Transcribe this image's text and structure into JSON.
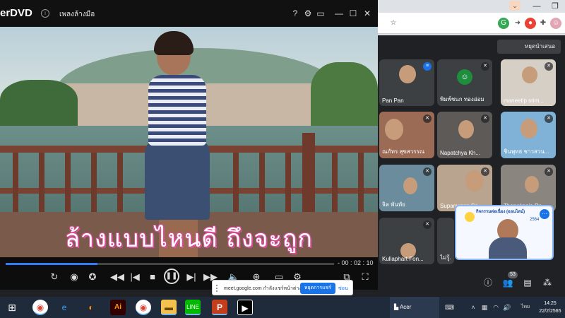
{
  "player": {
    "logo": "erDVD",
    "filename": "เพลงล้างมือ",
    "subtitle": "ล้างแบบไหนดี    ถึงจะถูก",
    "time": "- 00 : 02 : 10",
    "progress_fraction": 0.28
  },
  "meet": {
    "stop_presenting": "หยุดนำเสนอ",
    "people_count": "53",
    "participants": [
      {
        "name": "Pan Pan"
      },
      {
        "name": "พิมพ์ชนก ทองอ่อม"
      },
      {
        "name": "maneetip srim..."
      },
      {
        "name": "ณภัทร สุขสวรรณ"
      },
      {
        "name": "Napatchya Kh..."
      },
      {
        "name": "ชินพุทธ ชาวสวน..."
      },
      {
        "name": "จิต พันทัย"
      },
      {
        "name": "Supanwasa So..."
      },
      {
        "name": "Thanakanin Ra..."
      },
      {
        "name": "Kullaphart Fon..."
      },
      {
        "name": "ไม่รู้..."
      }
    ],
    "presenter_banner": "กิจกรรมต่อเนื่อง (ออนไลน์)",
    "presenter_year": "2564"
  },
  "share_bar": {
    "text": "meet.google.com กำลังแชร์หน้าต่าง",
    "stop": "หยุดการแชร์",
    "hide": "ซ่อน"
  },
  "taskbar": {
    "acer_label": "Acer",
    "lang": "ไทย",
    "time": "14:25",
    "date": "22/2/2565"
  },
  "colors": {
    "meet_bg": "#202124",
    "accent_blue": "#1a73e8",
    "subtitle_outline": "#d94f9a"
  }
}
